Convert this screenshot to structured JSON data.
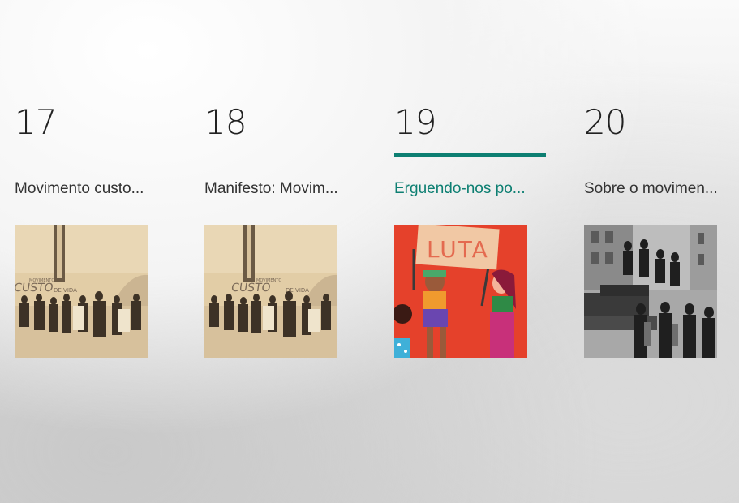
{
  "days": [
    {
      "number": "17",
      "title": "Movimento custo...",
      "image": "sepia-protest-photo"
    },
    {
      "number": "18",
      "title": "Manifesto: Movim...",
      "image": "sepia-protest-photo"
    },
    {
      "number": "19",
      "title": "Erguendo-nos po...",
      "image": "illustration-luta-protest",
      "sign_text": "LUTA",
      "active": true
    },
    {
      "number": "20",
      "title": "Sobre o movimen...",
      "image": "bw-revolution-photo"
    }
  ],
  "colors": {
    "accent": "#0d7f72",
    "text": "#333333"
  },
  "banner_text": {
    "custo": "CUSTO",
    "de_vida": "DE VIDA",
    "movimento": "MOVIMENTO"
  }
}
